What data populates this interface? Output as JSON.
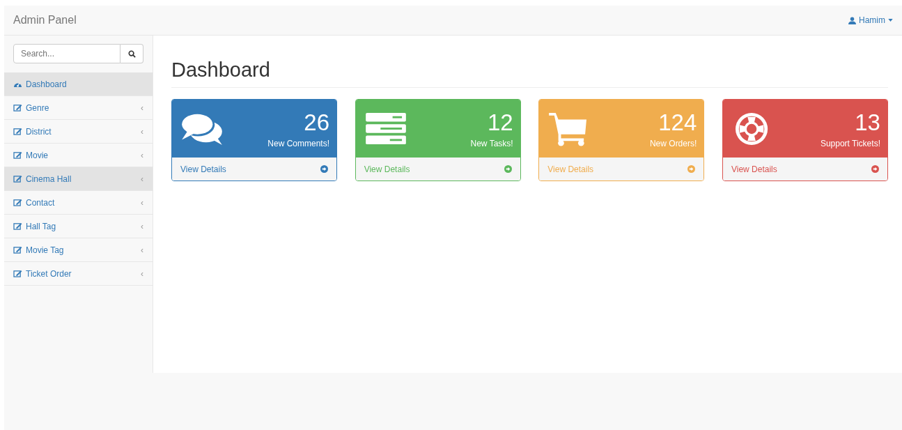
{
  "navbar": {
    "brand": "Admin Panel",
    "user": "Hamim"
  },
  "sidebar": {
    "search": {
      "placeholder": "Search..."
    },
    "items": [
      {
        "label": "Dashboard",
        "kind": "dashboard",
        "selected": true
      },
      {
        "label": "Genre",
        "kind": "edit",
        "arrow": "‹",
        "selected": false
      },
      {
        "label": "District",
        "kind": "edit",
        "arrow": "‹",
        "selected": false
      },
      {
        "label": "Movie",
        "kind": "edit",
        "arrow": "‹",
        "selected": false
      },
      {
        "label": "Cinema Hall",
        "kind": "edit",
        "arrow": "‹",
        "selected": true
      },
      {
        "label": "Contact",
        "kind": "edit",
        "arrow": "‹",
        "selected": false
      },
      {
        "label": "Hall Tag",
        "kind": "edit",
        "arrow": "‹",
        "selected": false
      },
      {
        "label": "Movie Tag",
        "kind": "edit",
        "arrow": "‹",
        "selected": false
      },
      {
        "label": "Ticket Order",
        "kind": "edit",
        "arrow": "‹",
        "selected": false
      }
    ]
  },
  "page_title": "Dashboard",
  "cards": [
    {
      "kind": "comments",
      "count": "26",
      "label": "New Comments!",
      "link": "View Details",
      "color": "#337ab7"
    },
    {
      "kind": "tasks",
      "count": "12",
      "label": "New Tasks!",
      "link": "View Details",
      "color": "#5cb85c"
    },
    {
      "kind": "cart",
      "count": "124",
      "label": "New Orders!",
      "link": "View Details",
      "color": "#f0ad4e"
    },
    {
      "kind": "support",
      "count": "13",
      "label": "Support Tickets!",
      "link": "View Details",
      "color": "#d9534f"
    }
  ]
}
